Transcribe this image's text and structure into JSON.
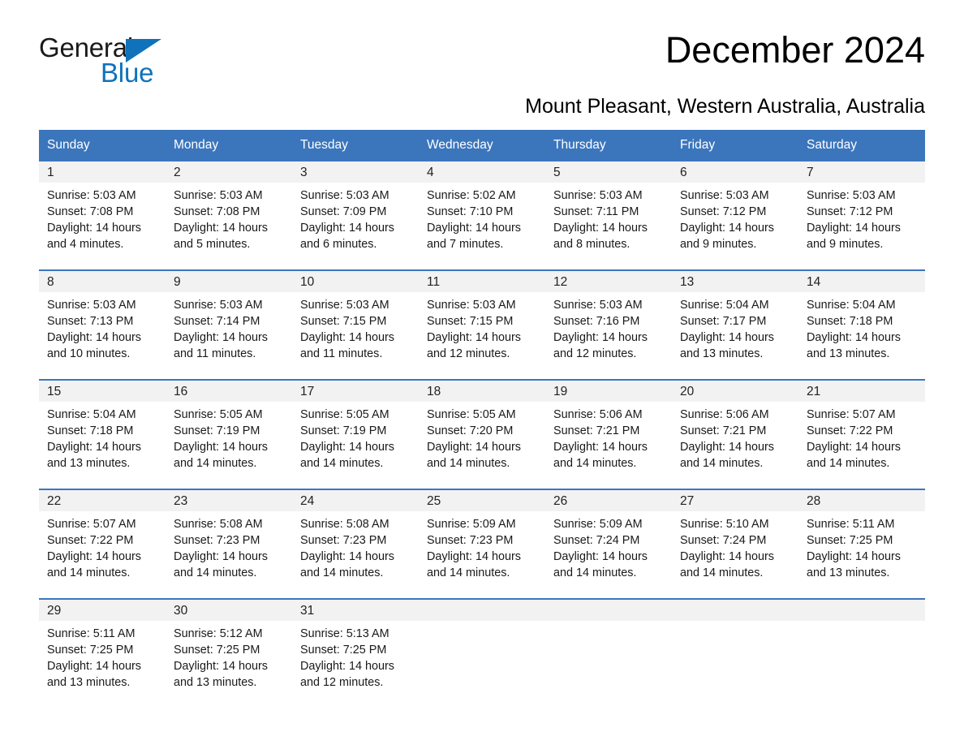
{
  "brand": {
    "name_part1": "General",
    "name_part2": "Blue",
    "triangle_icon": "triangle-icon",
    "accent_color": "#0f72bb"
  },
  "header": {
    "title": "December 2024",
    "subtitle": "Mount Pleasant, Western Australia, Australia"
  },
  "colors": {
    "header_bar": "#3b76bd",
    "daynum_band": "#f2f2f2",
    "text": "#000000",
    "header_text": "#ffffff"
  },
  "calendar": {
    "weekday_headers": [
      "Sunday",
      "Monday",
      "Tuesday",
      "Wednesday",
      "Thursday",
      "Friday",
      "Saturday"
    ],
    "weeks": [
      [
        {
          "day": "1",
          "sunrise": "Sunrise: 5:03 AM",
          "sunset": "Sunset: 7:08 PM",
          "daylight": "Daylight: 14 hours and 4 minutes."
        },
        {
          "day": "2",
          "sunrise": "Sunrise: 5:03 AM",
          "sunset": "Sunset: 7:08 PM",
          "daylight": "Daylight: 14 hours and 5 minutes."
        },
        {
          "day": "3",
          "sunrise": "Sunrise: 5:03 AM",
          "sunset": "Sunset: 7:09 PM",
          "daylight": "Daylight: 14 hours and 6 minutes."
        },
        {
          "day": "4",
          "sunrise": "Sunrise: 5:02 AM",
          "sunset": "Sunset: 7:10 PM",
          "daylight": "Daylight: 14 hours and 7 minutes."
        },
        {
          "day": "5",
          "sunrise": "Sunrise: 5:03 AM",
          "sunset": "Sunset: 7:11 PM",
          "daylight": "Daylight: 14 hours and 8 minutes."
        },
        {
          "day": "6",
          "sunrise": "Sunrise: 5:03 AM",
          "sunset": "Sunset: 7:12 PM",
          "daylight": "Daylight: 14 hours and 9 minutes."
        },
        {
          "day": "7",
          "sunrise": "Sunrise: 5:03 AM",
          "sunset": "Sunset: 7:12 PM",
          "daylight": "Daylight: 14 hours and 9 minutes."
        }
      ],
      [
        {
          "day": "8",
          "sunrise": "Sunrise: 5:03 AM",
          "sunset": "Sunset: 7:13 PM",
          "daylight": "Daylight: 14 hours and 10 minutes."
        },
        {
          "day": "9",
          "sunrise": "Sunrise: 5:03 AM",
          "sunset": "Sunset: 7:14 PM",
          "daylight": "Daylight: 14 hours and 11 minutes."
        },
        {
          "day": "10",
          "sunrise": "Sunrise: 5:03 AM",
          "sunset": "Sunset: 7:15 PM",
          "daylight": "Daylight: 14 hours and 11 minutes."
        },
        {
          "day": "11",
          "sunrise": "Sunrise: 5:03 AM",
          "sunset": "Sunset: 7:15 PM",
          "daylight": "Daylight: 14 hours and 12 minutes."
        },
        {
          "day": "12",
          "sunrise": "Sunrise: 5:03 AM",
          "sunset": "Sunset: 7:16 PM",
          "daylight": "Daylight: 14 hours and 12 minutes."
        },
        {
          "day": "13",
          "sunrise": "Sunrise: 5:04 AM",
          "sunset": "Sunset: 7:17 PM",
          "daylight": "Daylight: 14 hours and 13 minutes."
        },
        {
          "day": "14",
          "sunrise": "Sunrise: 5:04 AM",
          "sunset": "Sunset: 7:18 PM",
          "daylight": "Daylight: 14 hours and 13 minutes."
        }
      ],
      [
        {
          "day": "15",
          "sunrise": "Sunrise: 5:04 AM",
          "sunset": "Sunset: 7:18 PM",
          "daylight": "Daylight: 14 hours and 13 minutes."
        },
        {
          "day": "16",
          "sunrise": "Sunrise: 5:05 AM",
          "sunset": "Sunset: 7:19 PM",
          "daylight": "Daylight: 14 hours and 14 minutes."
        },
        {
          "day": "17",
          "sunrise": "Sunrise: 5:05 AM",
          "sunset": "Sunset: 7:19 PM",
          "daylight": "Daylight: 14 hours and 14 minutes."
        },
        {
          "day": "18",
          "sunrise": "Sunrise: 5:05 AM",
          "sunset": "Sunset: 7:20 PM",
          "daylight": "Daylight: 14 hours and 14 minutes."
        },
        {
          "day": "19",
          "sunrise": "Sunrise: 5:06 AM",
          "sunset": "Sunset: 7:21 PM",
          "daylight": "Daylight: 14 hours and 14 minutes."
        },
        {
          "day": "20",
          "sunrise": "Sunrise: 5:06 AM",
          "sunset": "Sunset: 7:21 PM",
          "daylight": "Daylight: 14 hours and 14 minutes."
        },
        {
          "day": "21",
          "sunrise": "Sunrise: 5:07 AM",
          "sunset": "Sunset: 7:22 PM",
          "daylight": "Daylight: 14 hours and 14 minutes."
        }
      ],
      [
        {
          "day": "22",
          "sunrise": "Sunrise: 5:07 AM",
          "sunset": "Sunset: 7:22 PM",
          "daylight": "Daylight: 14 hours and 14 minutes."
        },
        {
          "day": "23",
          "sunrise": "Sunrise: 5:08 AM",
          "sunset": "Sunset: 7:23 PM",
          "daylight": "Daylight: 14 hours and 14 minutes."
        },
        {
          "day": "24",
          "sunrise": "Sunrise: 5:08 AM",
          "sunset": "Sunset: 7:23 PM",
          "daylight": "Daylight: 14 hours and 14 minutes."
        },
        {
          "day": "25",
          "sunrise": "Sunrise: 5:09 AM",
          "sunset": "Sunset: 7:23 PM",
          "daylight": "Daylight: 14 hours and 14 minutes."
        },
        {
          "day": "26",
          "sunrise": "Sunrise: 5:09 AM",
          "sunset": "Sunset: 7:24 PM",
          "daylight": "Daylight: 14 hours and 14 minutes."
        },
        {
          "day": "27",
          "sunrise": "Sunrise: 5:10 AM",
          "sunset": "Sunset: 7:24 PM",
          "daylight": "Daylight: 14 hours and 14 minutes."
        },
        {
          "day": "28",
          "sunrise": "Sunrise: 5:11 AM",
          "sunset": "Sunset: 7:25 PM",
          "daylight": "Daylight: 14 hours and 13 minutes."
        }
      ],
      [
        {
          "day": "29",
          "sunrise": "Sunrise: 5:11 AM",
          "sunset": "Sunset: 7:25 PM",
          "daylight": "Daylight: 14 hours and 13 minutes."
        },
        {
          "day": "30",
          "sunrise": "Sunrise: 5:12 AM",
          "sunset": "Sunset: 7:25 PM",
          "daylight": "Daylight: 14 hours and 13 minutes."
        },
        {
          "day": "31",
          "sunrise": "Sunrise: 5:13 AM",
          "sunset": "Sunset: 7:25 PM",
          "daylight": "Daylight: 14 hours and 12 minutes."
        },
        {
          "day": "",
          "sunrise": "",
          "sunset": "",
          "daylight": ""
        },
        {
          "day": "",
          "sunrise": "",
          "sunset": "",
          "daylight": ""
        },
        {
          "day": "",
          "sunrise": "",
          "sunset": "",
          "daylight": ""
        },
        {
          "day": "",
          "sunrise": "",
          "sunset": "",
          "daylight": ""
        }
      ]
    ]
  }
}
